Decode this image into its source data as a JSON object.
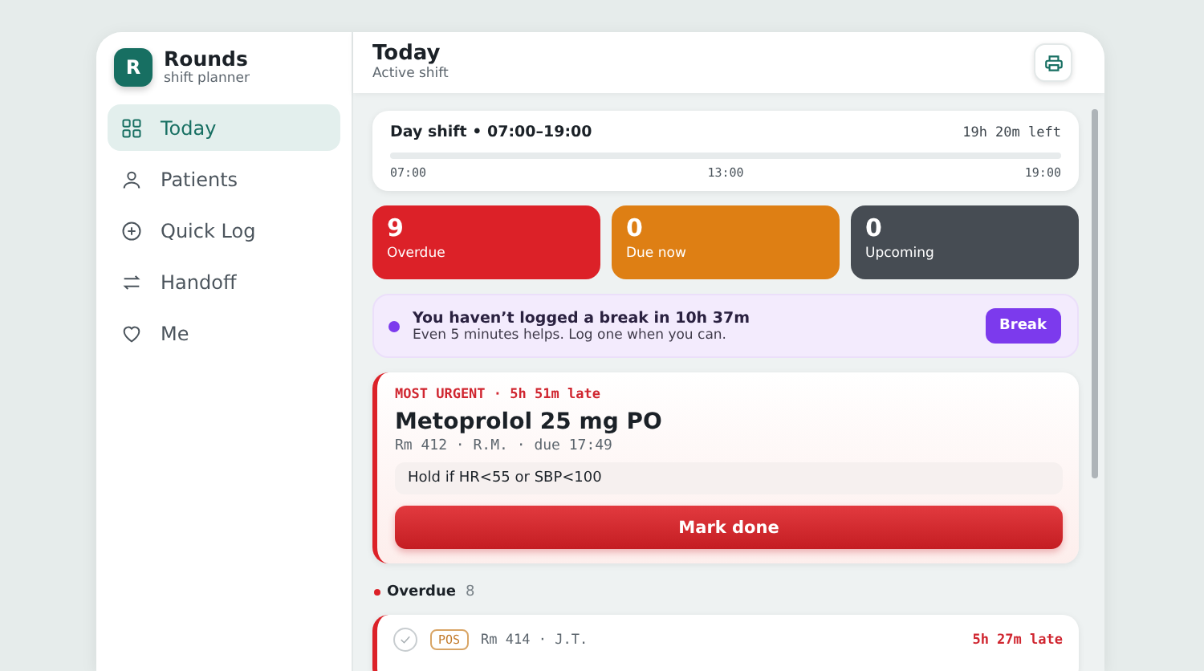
{
  "app": {
    "logo_letter": "R",
    "name": "Rounds",
    "subtitle": "shift planner"
  },
  "nav": [
    {
      "label": "Today",
      "kind": "grid",
      "selected": true
    },
    {
      "label": "Patients",
      "kind": "person",
      "selected": false
    },
    {
      "label": "Quick Log",
      "kind": "plus",
      "selected": false
    },
    {
      "label": "Handoff",
      "kind": "swap",
      "selected": false
    },
    {
      "label": "Me",
      "kind": "heart",
      "selected": false
    }
  ],
  "header": {
    "title": "Today",
    "subtitle": "Active shift"
  },
  "shift": {
    "title": "Day shift • 07:00–19:00",
    "remaining": "19h 20m left",
    "ticks": [
      "07:00",
      "13:00",
      "19:00"
    ]
  },
  "stats": [
    {
      "count": "9",
      "label": "Overdue",
      "color": "#dc2128"
    },
    {
      "count": "0",
      "label": "Due now",
      "color": "#de7f14"
    },
    {
      "count": "0",
      "label": "Upcoming",
      "color": "#464c53"
    }
  ],
  "break_banner": {
    "title": "You haven’t logged a break in 10h 37m",
    "text": "Even 5 minutes helps. Log one when you can.",
    "button": "Break"
  },
  "urgent": {
    "eyebrow": "MOST URGENT · 5h 51m late",
    "title": "Metoprolol 25 mg PO",
    "meta": "Rm 412 · R.M. · due 17:49",
    "note": "Hold if HR<55 or SBP<100",
    "button": "Mark done"
  },
  "overdue": {
    "label": "Overdue",
    "count": "8",
    "items": [
      {
        "tag": "POS",
        "meta": "Rm 414 · J.T.",
        "late": "5h 27m late"
      }
    ]
  }
}
